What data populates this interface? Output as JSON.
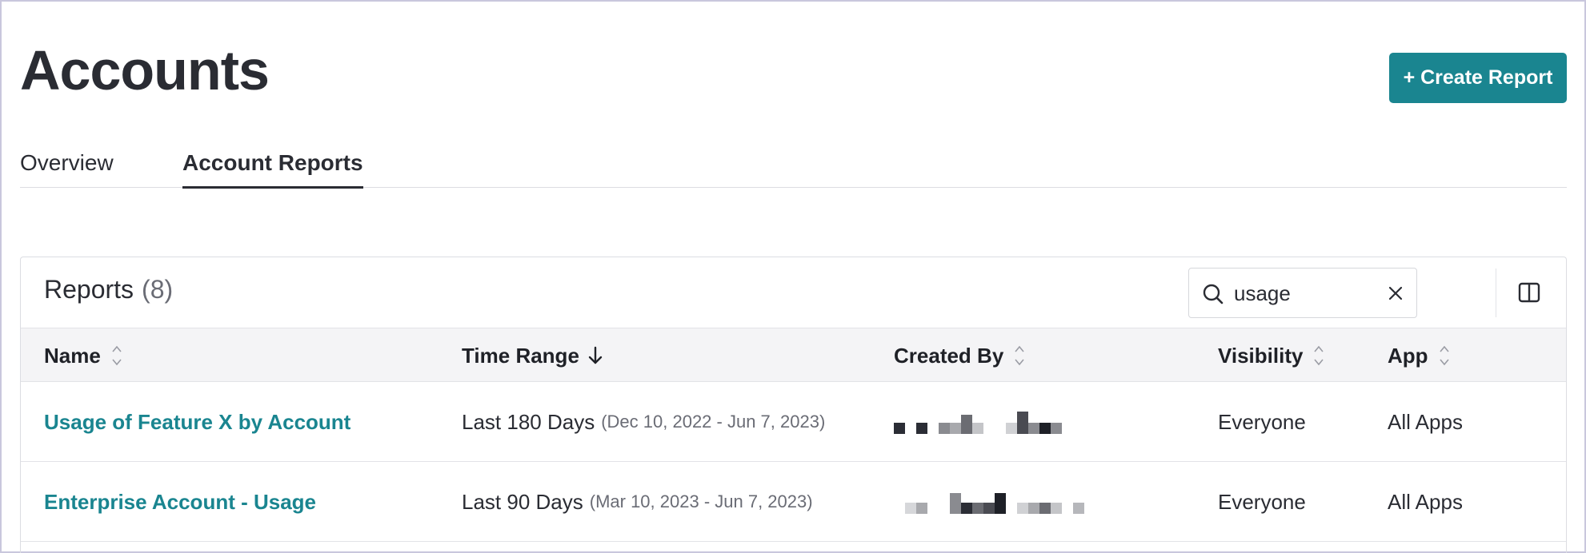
{
  "header": {
    "title": "Accounts",
    "create_label": "+ Create Report"
  },
  "tabs": [
    {
      "label": "Overview",
      "active": false
    },
    {
      "label": "Account Reports",
      "active": true
    }
  ],
  "reports": {
    "title": "Reports",
    "count": "(8)",
    "search": {
      "value": "usage",
      "placeholder": ""
    },
    "columns": [
      {
        "label": "Name",
        "sort": "none"
      },
      {
        "label": "Time Range",
        "sort": "desc"
      },
      {
        "label": "Created By",
        "sort": "none"
      },
      {
        "label": "Visibility",
        "sort": "none"
      },
      {
        "label": "App",
        "sort": "none"
      }
    ],
    "rows": [
      {
        "name": "Usage of Feature X by Account",
        "range": "Last 180 Days",
        "range_dates": "(Dec 10, 2022 - Jun 7, 2023)",
        "created_by": "redacted",
        "visibility": "Everyone",
        "app": "All Apps"
      },
      {
        "name": "Enterprise Account - Usage",
        "range": "Last 90 Days",
        "range_dates": "(Mar 10, 2023 - Jun 7, 2023)",
        "created_by": "redacted",
        "visibility": "Everyone",
        "app": "All Apps"
      }
    ]
  },
  "colors": {
    "accent": "#1a8590",
    "text": "#2a2c33",
    "muted": "#6a6c75",
    "header_bg": "#f4f4f6",
    "border": "#e2e3e7"
  },
  "icons": {
    "search": "search-icon",
    "clear": "close-icon",
    "columns": "columns-icon",
    "sort": "sort-icon",
    "sort_desc": "arrow-down-icon"
  }
}
